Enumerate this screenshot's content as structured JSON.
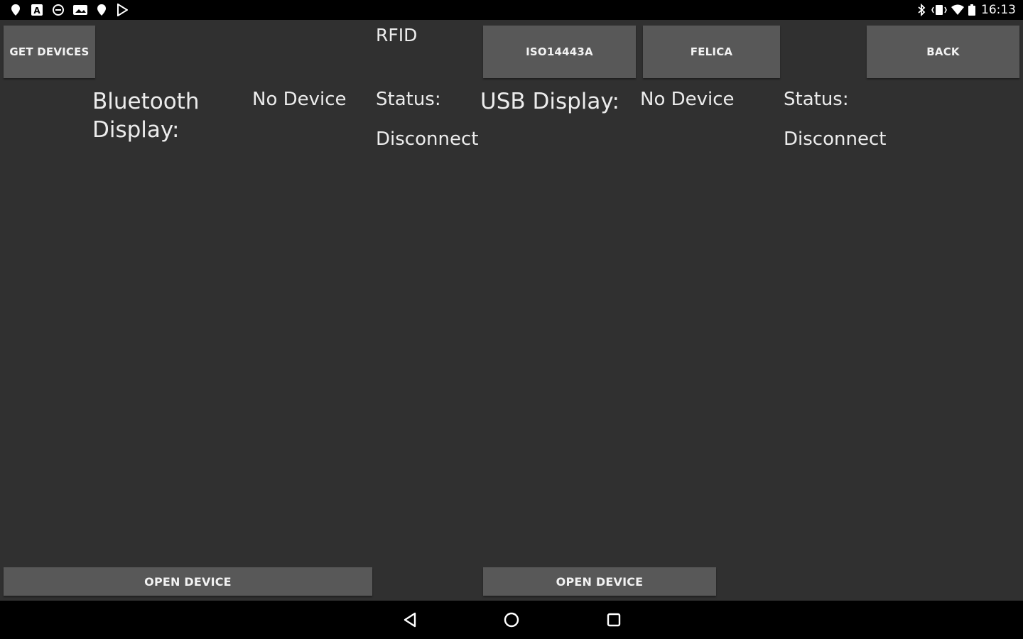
{
  "status_bar": {
    "time": "16:13",
    "left_icons": [
      "location-pin-icon",
      "notification-a-icon",
      "sync-icon",
      "photo-icon",
      "location-pin-icon",
      "play-store-icon"
    ],
    "right_icons": [
      "bluetooth-icon",
      "vibrate-icon",
      "wifi-icon",
      "battery-icon"
    ]
  },
  "toolbar": {
    "get_devices_label": "GET DEVICES",
    "title": "RFID",
    "iso_label": "ISO14443A",
    "felica_label": "FELICA",
    "back_label": "BACK"
  },
  "bluetooth": {
    "label_line1": "Bluetooth",
    "label_line2": "Display:",
    "device": "No Device",
    "status_label": "Status:",
    "status_value": "Disconnect",
    "open_label": "OPEN DEVICE"
  },
  "usb": {
    "label": "USB Display:",
    "device": "No Device",
    "status_label": "Status:",
    "status_value": "Disconnect",
    "open_label": "OPEN DEVICE"
  },
  "nav_bar": {
    "icons": [
      "back-icon",
      "home-icon",
      "recents-icon"
    ]
  },
  "colors": {
    "background": "#303030",
    "button": "#585858",
    "bars": "#000000",
    "text": "#ececec"
  }
}
